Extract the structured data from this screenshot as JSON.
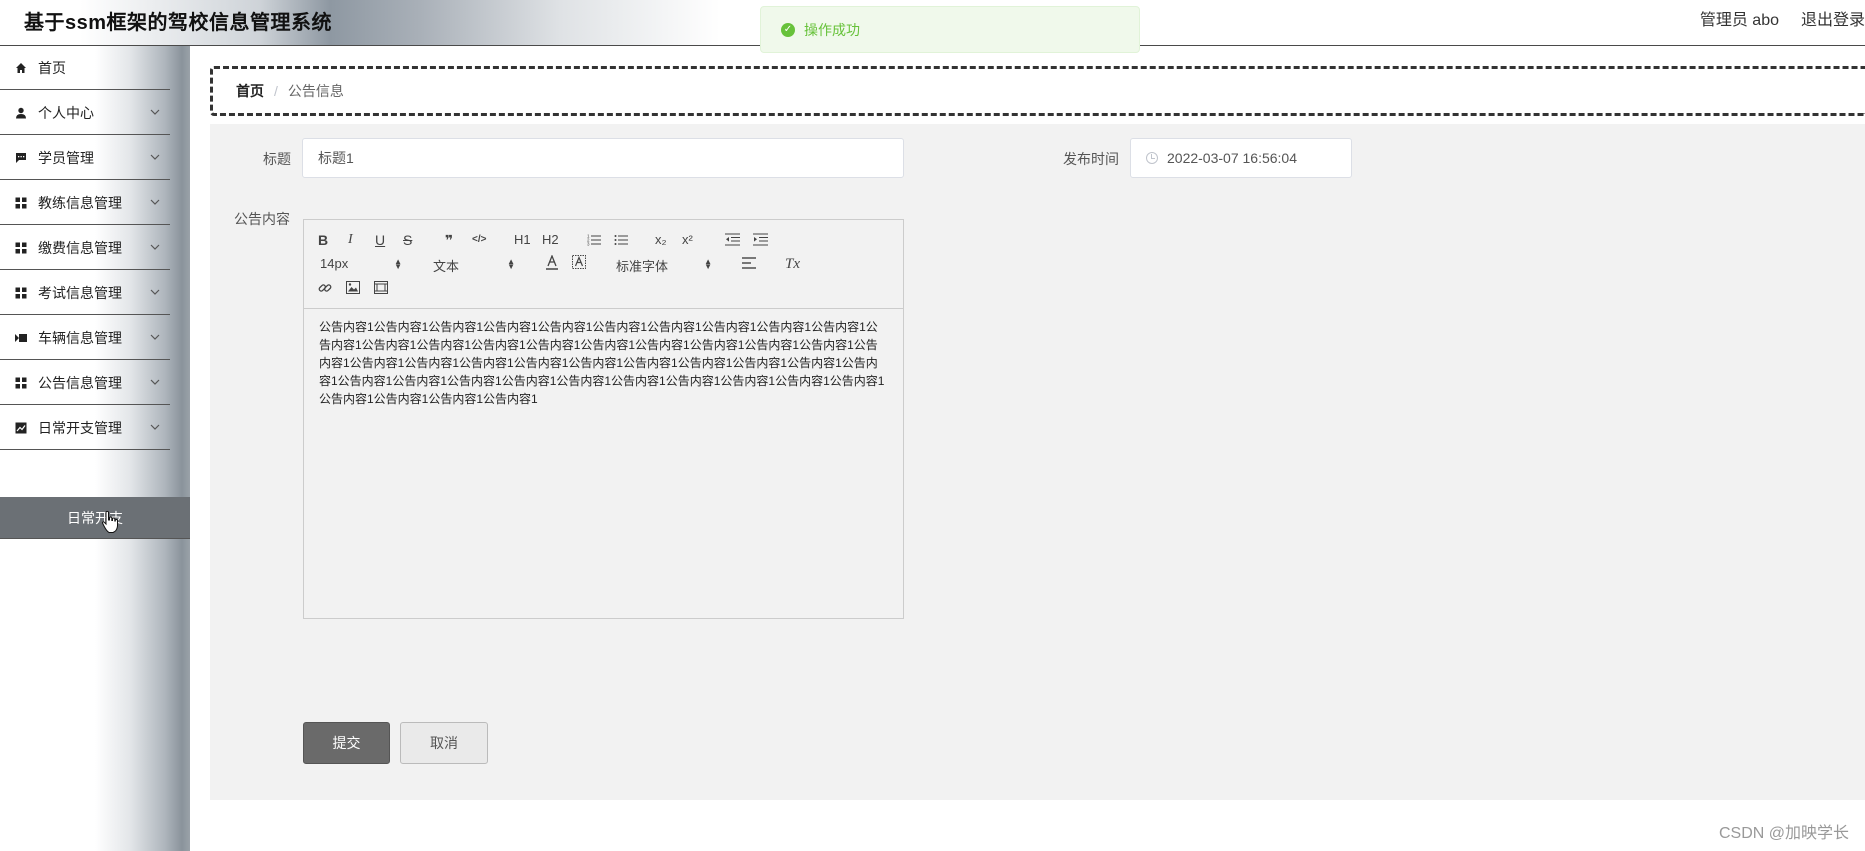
{
  "header": {
    "title": "基于ssm框架的驾校信息管理系统",
    "user_label": "管理员 abo",
    "logout_label": "退出登录"
  },
  "toast": {
    "message": "操作成功",
    "status_color": "#67c23a"
  },
  "sidebar": {
    "items": [
      {
        "label": "首页",
        "icon": "home-icon",
        "has_arrow": false
      },
      {
        "label": "个人中心",
        "icon": "user-icon",
        "has_arrow": true
      },
      {
        "label": "学员管理",
        "icon": "chat-icon",
        "has_arrow": true
      },
      {
        "label": "教练信息管理",
        "icon": "grid-icon",
        "has_arrow": true
      },
      {
        "label": "缴费信息管理",
        "icon": "grid-icon",
        "has_arrow": true
      },
      {
        "label": "考试信息管理",
        "icon": "grid-icon",
        "has_arrow": true
      },
      {
        "label": "车辆信息管理",
        "icon": "video-icon",
        "has_arrow": true
      },
      {
        "label": "公告信息管理",
        "icon": "grid-icon",
        "has_arrow": true
      },
      {
        "label": "日常开支管理",
        "icon": "chart-icon",
        "has_arrow": true
      }
    ],
    "sub_item": "日常开支"
  },
  "breadcrumb": {
    "home": "首页",
    "separator": "/",
    "current": "公告信息"
  },
  "form": {
    "title_label": "标题",
    "title_value": "标题1",
    "time_label": "发布时间",
    "time_value": "2022-03-07 16:56:04",
    "content_label": "公告内容",
    "content_value": "公告内容1公告内容1公告内容1公告内容1公告内容1公告内容1公告内容1公告内容1公告内容1公告内容1公告内容1公告内容1公告内容1公告内容1公告内容1公告内容1公告内容1公告内容1公告内容1公告内容1公告内容1公告内容1公告内容1公告内容1公告内容1公告内容1公告内容1公告内容1公告内容1公告内容1公告内容1公告内容1公告内容1公告内容1公告内容1公告内容1公告内容1公告内容1公告内容1公告内容1公告内容1公告内容1公告内容1公告内容1公告内容1"
  },
  "editor_toolbar": {
    "bold": "B",
    "italic": "I",
    "underline": "U",
    "strike": "S",
    "quote": "❞",
    "code": "</>",
    "h1": "H1",
    "h2": "H2",
    "subscript": "x₂",
    "superscript": "x²",
    "size": "14px",
    "header_type": "文本",
    "font": "标准字体",
    "clean": "Tx"
  },
  "buttons": {
    "submit": "提交",
    "cancel": "取消"
  },
  "watermark": "CSDN @加映学长"
}
